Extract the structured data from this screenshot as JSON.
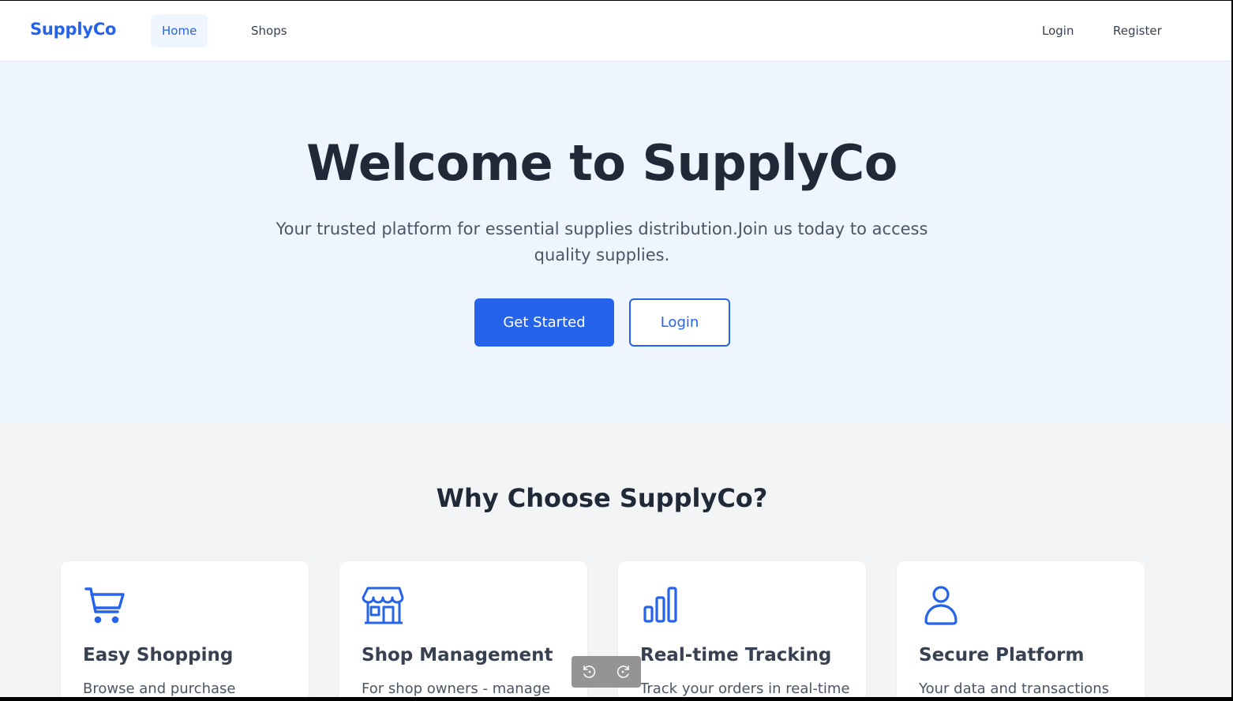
{
  "nav": {
    "brand": "SupplyCo",
    "links": [
      {
        "label": "Home",
        "active": true
      },
      {
        "label": "Shops",
        "active": false
      }
    ],
    "auth": [
      {
        "label": "Login"
      },
      {
        "label": "Register"
      }
    ]
  },
  "hero": {
    "title": "Welcome to SupplyCo",
    "subtitle": "Your trusted platform for essential supplies distribution.Join us today to access quality supplies.",
    "primary_button": "Get Started",
    "secondary_button": "Login"
  },
  "features": {
    "title": "Why Choose SupplyCo?",
    "cards": [
      {
        "icon": "shopping-cart-icon",
        "title": "Easy Shopping",
        "desc": "Browse and purchase"
      },
      {
        "icon": "storefront-icon",
        "title": "Shop Management",
        "desc": "For shop owners - manage"
      },
      {
        "icon": "bar-chart-icon",
        "title": "Real-time Tracking",
        "desc": "Track your orders in real-time"
      },
      {
        "icon": "user-icon",
        "title": "Secure Platform",
        "desc": "Your data and transactions"
      }
    ]
  },
  "colors": {
    "accent": "#2563eb",
    "hero_bg": "#eef5ff",
    "page_bg": "#f3f4f6",
    "heading": "#1f2937"
  },
  "media_controls": [
    "rotate-left-icon",
    "rotate-right-icon"
  ]
}
